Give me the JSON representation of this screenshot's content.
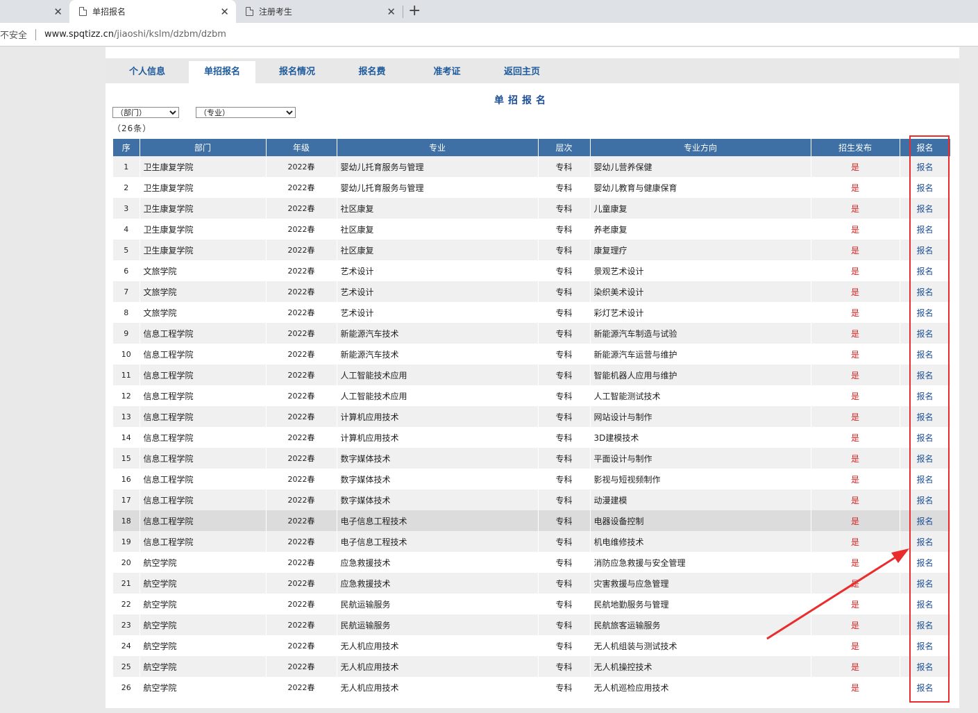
{
  "browser": {
    "tabs": [
      {
        "label": ""
      },
      {
        "label": "单招报名"
      },
      {
        "label": "注册考生"
      }
    ],
    "close_glyph": "✕",
    "new_tab_glyph": "+",
    "security_label": "不安全",
    "url_host": "www.spqtizz.cn",
    "url_path": "/jiaoshi/kslm/dzbm/dzbm"
  },
  "nav": {
    "items": [
      {
        "label": "个人信息"
      },
      {
        "label": "单招报名"
      },
      {
        "label": "报名情况"
      },
      {
        "label": "报名费"
      },
      {
        "label": "准考证"
      },
      {
        "label": "返回主页"
      }
    ],
    "active": "单招报名"
  },
  "page": {
    "title": "单招报名",
    "dept_select": "（部门）",
    "major_select": "（专业）",
    "count": "（26条）"
  },
  "table": {
    "headers": [
      "序",
      "部门",
      "年级",
      "专业",
      "层次",
      "专业方向",
      "招生发布",
      "报名"
    ],
    "rows": [
      {
        "seq": "1",
        "dept": "卫生康复学院",
        "year": "2022春",
        "major": "婴幼儿托育服务与管理",
        "level": "专科",
        "direction": "婴幼儿营养保健",
        "published": "是",
        "action": "报名"
      },
      {
        "seq": "2",
        "dept": "卫生康复学院",
        "year": "2022春",
        "major": "婴幼儿托育服务与管理",
        "level": "专科",
        "direction": "婴幼儿教育与健康保育",
        "published": "是",
        "action": "报名"
      },
      {
        "seq": "3",
        "dept": "卫生康复学院",
        "year": "2022春",
        "major": "社区康复",
        "level": "专科",
        "direction": "儿童康复",
        "published": "是",
        "action": "报名"
      },
      {
        "seq": "4",
        "dept": "卫生康复学院",
        "year": "2022春",
        "major": "社区康复",
        "level": "专科",
        "direction": "养老康复",
        "published": "是",
        "action": "报名"
      },
      {
        "seq": "5",
        "dept": "卫生康复学院",
        "year": "2022春",
        "major": "社区康复",
        "level": "专科",
        "direction": "康复理疗",
        "published": "是",
        "action": "报名"
      },
      {
        "seq": "6",
        "dept": "文旅学院",
        "year": "2022春",
        "major": "艺术设计",
        "level": "专科",
        "direction": "景观艺术设计",
        "published": "是",
        "action": "报名"
      },
      {
        "seq": "7",
        "dept": "文旅学院",
        "year": "2022春",
        "major": "艺术设计",
        "level": "专科",
        "direction": "染织美术设计",
        "published": "是",
        "action": "报名"
      },
      {
        "seq": "8",
        "dept": "文旅学院",
        "year": "2022春",
        "major": "艺术设计",
        "level": "专科",
        "direction": "彩灯艺术设计",
        "published": "是",
        "action": "报名"
      },
      {
        "seq": "9",
        "dept": "信息工程学院",
        "year": "2022春",
        "major": "新能源汽车技术",
        "level": "专科",
        "direction": "新能源汽车制造与试验",
        "published": "是",
        "action": "报名"
      },
      {
        "seq": "10",
        "dept": "信息工程学院",
        "year": "2022春",
        "major": "新能源汽车技术",
        "level": "专科",
        "direction": "新能源汽车运营与维护",
        "published": "是",
        "action": "报名"
      },
      {
        "seq": "11",
        "dept": "信息工程学院",
        "year": "2022春",
        "major": "人工智能技术应用",
        "level": "专科",
        "direction": "智能机器人应用与维护",
        "published": "是",
        "action": "报名"
      },
      {
        "seq": "12",
        "dept": "信息工程学院",
        "year": "2022春",
        "major": "人工智能技术应用",
        "level": "专科",
        "direction": "人工智能测试技术",
        "published": "是",
        "action": "报名"
      },
      {
        "seq": "13",
        "dept": "信息工程学院",
        "year": "2022春",
        "major": "计算机应用技术",
        "level": "专科",
        "direction": "网站设计与制作",
        "published": "是",
        "action": "报名"
      },
      {
        "seq": "14",
        "dept": "信息工程学院",
        "year": "2022春",
        "major": "计算机应用技术",
        "level": "专科",
        "direction": "3D建模技术",
        "published": "是",
        "action": "报名"
      },
      {
        "seq": "15",
        "dept": "信息工程学院",
        "year": "2022春",
        "major": "数字媒体技术",
        "level": "专科",
        "direction": "平面设计与制作",
        "published": "是",
        "action": "报名"
      },
      {
        "seq": "16",
        "dept": "信息工程学院",
        "year": "2022春",
        "major": "数字媒体技术",
        "level": "专科",
        "direction": "影视与短视频制作",
        "published": "是",
        "action": "报名"
      },
      {
        "seq": "17",
        "dept": "信息工程学院",
        "year": "2022春",
        "major": "数字媒体技术",
        "level": "专科",
        "direction": "动漫建模",
        "published": "是",
        "action": "报名"
      },
      {
        "seq": "18",
        "dept": "信息工程学院",
        "year": "2022春",
        "major": "电子信息工程技术",
        "level": "专科",
        "direction": "电器设备控制",
        "published": "是",
        "action": "报名"
      },
      {
        "seq": "19",
        "dept": "信息工程学院",
        "year": "2022春",
        "major": "电子信息工程技术",
        "level": "专科",
        "direction": "机电维修技术",
        "published": "是",
        "action": "报名"
      },
      {
        "seq": "20",
        "dept": "航空学院",
        "year": "2022春",
        "major": "应急救援技术",
        "level": "专科",
        "direction": "消防应急救援与安全管理",
        "published": "是",
        "action": "报名"
      },
      {
        "seq": "21",
        "dept": "航空学院",
        "year": "2022春",
        "major": "应急救援技术",
        "level": "专科",
        "direction": "灾害救援与应急管理",
        "published": "是",
        "action": "报名"
      },
      {
        "seq": "22",
        "dept": "航空学院",
        "year": "2022春",
        "major": "民航运输服务",
        "level": "专科",
        "direction": "民航地勤服务与管理",
        "published": "是",
        "action": "报名"
      },
      {
        "seq": "23",
        "dept": "航空学院",
        "year": "2022春",
        "major": "民航运输服务",
        "level": "专科",
        "direction": "民航旅客运输服务",
        "published": "是",
        "action": "报名"
      },
      {
        "seq": "24",
        "dept": "航空学院",
        "year": "2022春",
        "major": "无人机应用技术",
        "level": "专科",
        "direction": "无人机组装与测试技术",
        "published": "是",
        "action": "报名"
      },
      {
        "seq": "25",
        "dept": "航空学院",
        "year": "2022春",
        "major": "无人机应用技术",
        "level": "专科",
        "direction": "无人机操控技术",
        "published": "是",
        "action": "报名"
      },
      {
        "seq": "26",
        "dept": "航空学院",
        "year": "2022春",
        "major": "无人机应用技术",
        "level": "专科",
        "direction": "无人机巡检应用技术",
        "published": "是",
        "action": "报名"
      }
    ],
    "highlighted_row": "18"
  },
  "colors": {
    "header_bg": "#3f70a5",
    "nav_text": "#1c5a9b",
    "published_red": "#d52222",
    "annotation_red": "#ea2c2c"
  }
}
